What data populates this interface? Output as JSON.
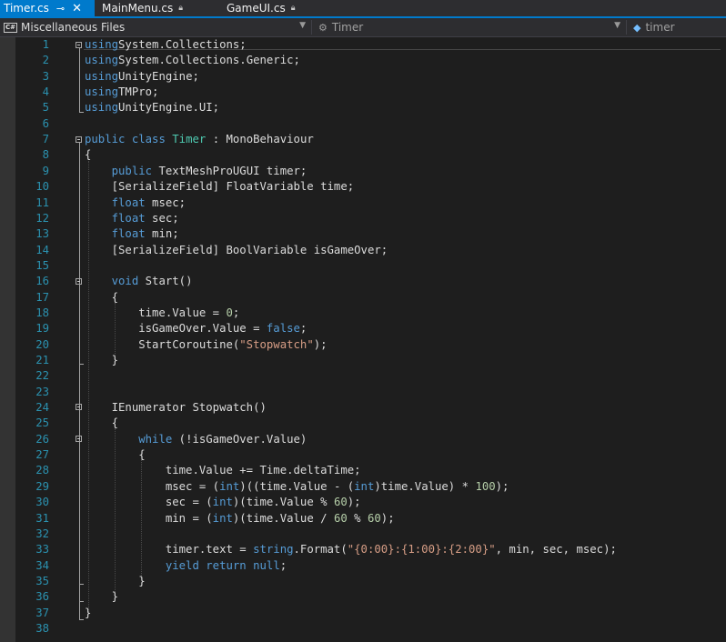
{
  "tabs": [
    {
      "label": "Timer.cs",
      "active": true,
      "pinned": true
    },
    {
      "label": "MainMenu.cs",
      "active": false,
      "locked": true
    },
    {
      "label": "GameUI.cs",
      "active": false,
      "locked": true
    }
  ],
  "nav": {
    "project": "Miscellaneous Files",
    "type": "Timer",
    "member": "timer"
  },
  "colors": {
    "keyword": "#569cd6",
    "type": "#4ec9b0",
    "string": "#d69d85",
    "number": "#b5cea8",
    "line_number": "#2b91af",
    "accent": "#007acc"
  },
  "code": [
    [
      [
        "kw",
        "using"
      ],
      [
        "",
        "System.Collections;"
      ]
    ],
    [
      [
        "kw",
        "using"
      ],
      [
        "",
        "System.Collections.Generic;"
      ]
    ],
    [
      [
        "kw",
        "using"
      ],
      [
        "",
        "UnityEngine;"
      ]
    ],
    [
      [
        "kw",
        "using"
      ],
      [
        "",
        "TMPro;"
      ]
    ],
    [
      [
        "kw",
        "using"
      ],
      [
        "",
        "UnityEngine.UI;"
      ]
    ],
    [],
    [
      [
        "kw",
        "public"
      ],
      [
        "",
        " "
      ],
      [
        "kw",
        "class"
      ],
      [
        "",
        " "
      ],
      [
        "tp",
        "Timer"
      ],
      [
        "",
        " : MonoBehaviour"
      ]
    ],
    [
      [
        "",
        "{"
      ]
    ],
    [
      [
        "",
        "    "
      ],
      [
        "kw",
        "public"
      ],
      [
        "",
        " TextMeshProUGUI timer;"
      ]
    ],
    [
      [
        "",
        "    [SerializeField] FloatVariable time;"
      ]
    ],
    [
      [
        "",
        "    "
      ],
      [
        "kw",
        "float"
      ],
      [
        "",
        " msec;"
      ]
    ],
    [
      [
        "",
        "    "
      ],
      [
        "kw",
        "float"
      ],
      [
        "",
        " sec;"
      ]
    ],
    [
      [
        "",
        "    "
      ],
      [
        "kw",
        "float"
      ],
      [
        "",
        " min;"
      ]
    ],
    [
      [
        "",
        "    [SerializeField] BoolVariable isGameOver;"
      ]
    ],
    [],
    [
      [
        "",
        "    "
      ],
      [
        "kw",
        "void"
      ],
      [
        "",
        " Start()"
      ]
    ],
    [
      [
        "",
        "    {"
      ]
    ],
    [
      [
        "",
        "        time.Value = "
      ],
      [
        "nm",
        "0"
      ],
      [
        "",
        ";"
      ]
    ],
    [
      [
        "",
        "        isGameOver.Value = "
      ],
      [
        "kw",
        "false"
      ],
      [
        "",
        ";"
      ]
    ],
    [
      [
        "",
        "        StartCoroutine("
      ],
      [
        "st",
        "\"Stopwatch\""
      ],
      [
        "",
        ");"
      ]
    ],
    [
      [
        "",
        "    }"
      ]
    ],
    [],
    [],
    [
      [
        "",
        "    IEnumerator Stopwatch()"
      ]
    ],
    [
      [
        "",
        "    {"
      ]
    ],
    [
      [
        "",
        "        "
      ],
      [
        "kw",
        "while"
      ],
      [
        "",
        " (!isGameOver.Value)"
      ]
    ],
    [
      [
        "",
        "        {"
      ]
    ],
    [
      [
        "",
        "            time.Value += Time.deltaTime;"
      ]
    ],
    [
      [
        "",
        "            msec = ("
      ],
      [
        "kw",
        "int"
      ],
      [
        "",
        ")((time.Value - ("
      ],
      [
        "kw",
        "int"
      ],
      [
        "",
        ")time.Value) * "
      ],
      [
        "nm",
        "100"
      ],
      [
        "",
        ");"
      ]
    ],
    [
      [
        "",
        "            sec = ("
      ],
      [
        "kw",
        "int"
      ],
      [
        "",
        ")(time.Value % "
      ],
      [
        "nm",
        "60"
      ],
      [
        "",
        ");"
      ]
    ],
    [
      [
        "",
        "            min = ("
      ],
      [
        "kw",
        "int"
      ],
      [
        "",
        ")(time.Value / "
      ],
      [
        "nm",
        "60"
      ],
      [
        "",
        " % "
      ],
      [
        "nm",
        "60"
      ],
      [
        "",
        ");"
      ]
    ],
    [],
    [
      [
        "",
        "            timer.text = "
      ],
      [
        "kw",
        "string"
      ],
      [
        "",
        ".Format("
      ],
      [
        "st",
        "\"{0:00}:{1:00}:{2:00}\""
      ],
      [
        "",
        ", min, sec, msec);"
      ]
    ],
    [
      [
        "",
        "            "
      ],
      [
        "kw",
        "yield"
      ],
      [
        "",
        " "
      ],
      [
        "kw",
        "return"
      ],
      [
        "",
        " "
      ],
      [
        "kw",
        "null"
      ],
      [
        "",
        ";"
      ]
    ],
    [
      [
        "",
        "        }"
      ]
    ],
    [
      [
        "",
        "    }"
      ]
    ],
    [
      [
        "",
        "}"
      ]
    ],
    []
  ],
  "line_numbers": [
    "1",
    "2",
    "3",
    "4",
    "5",
    "6",
    "7",
    "8",
    "9",
    "10",
    "11",
    "12",
    "13",
    "14",
    "15",
    "16",
    "17",
    "18",
    "19",
    "20",
    "21",
    "22",
    "23",
    "24",
    "25",
    "26",
    "27",
    "28",
    "29",
    "30",
    "31",
    "32",
    "33",
    "34",
    "35",
    "36",
    "37",
    "38"
  ]
}
